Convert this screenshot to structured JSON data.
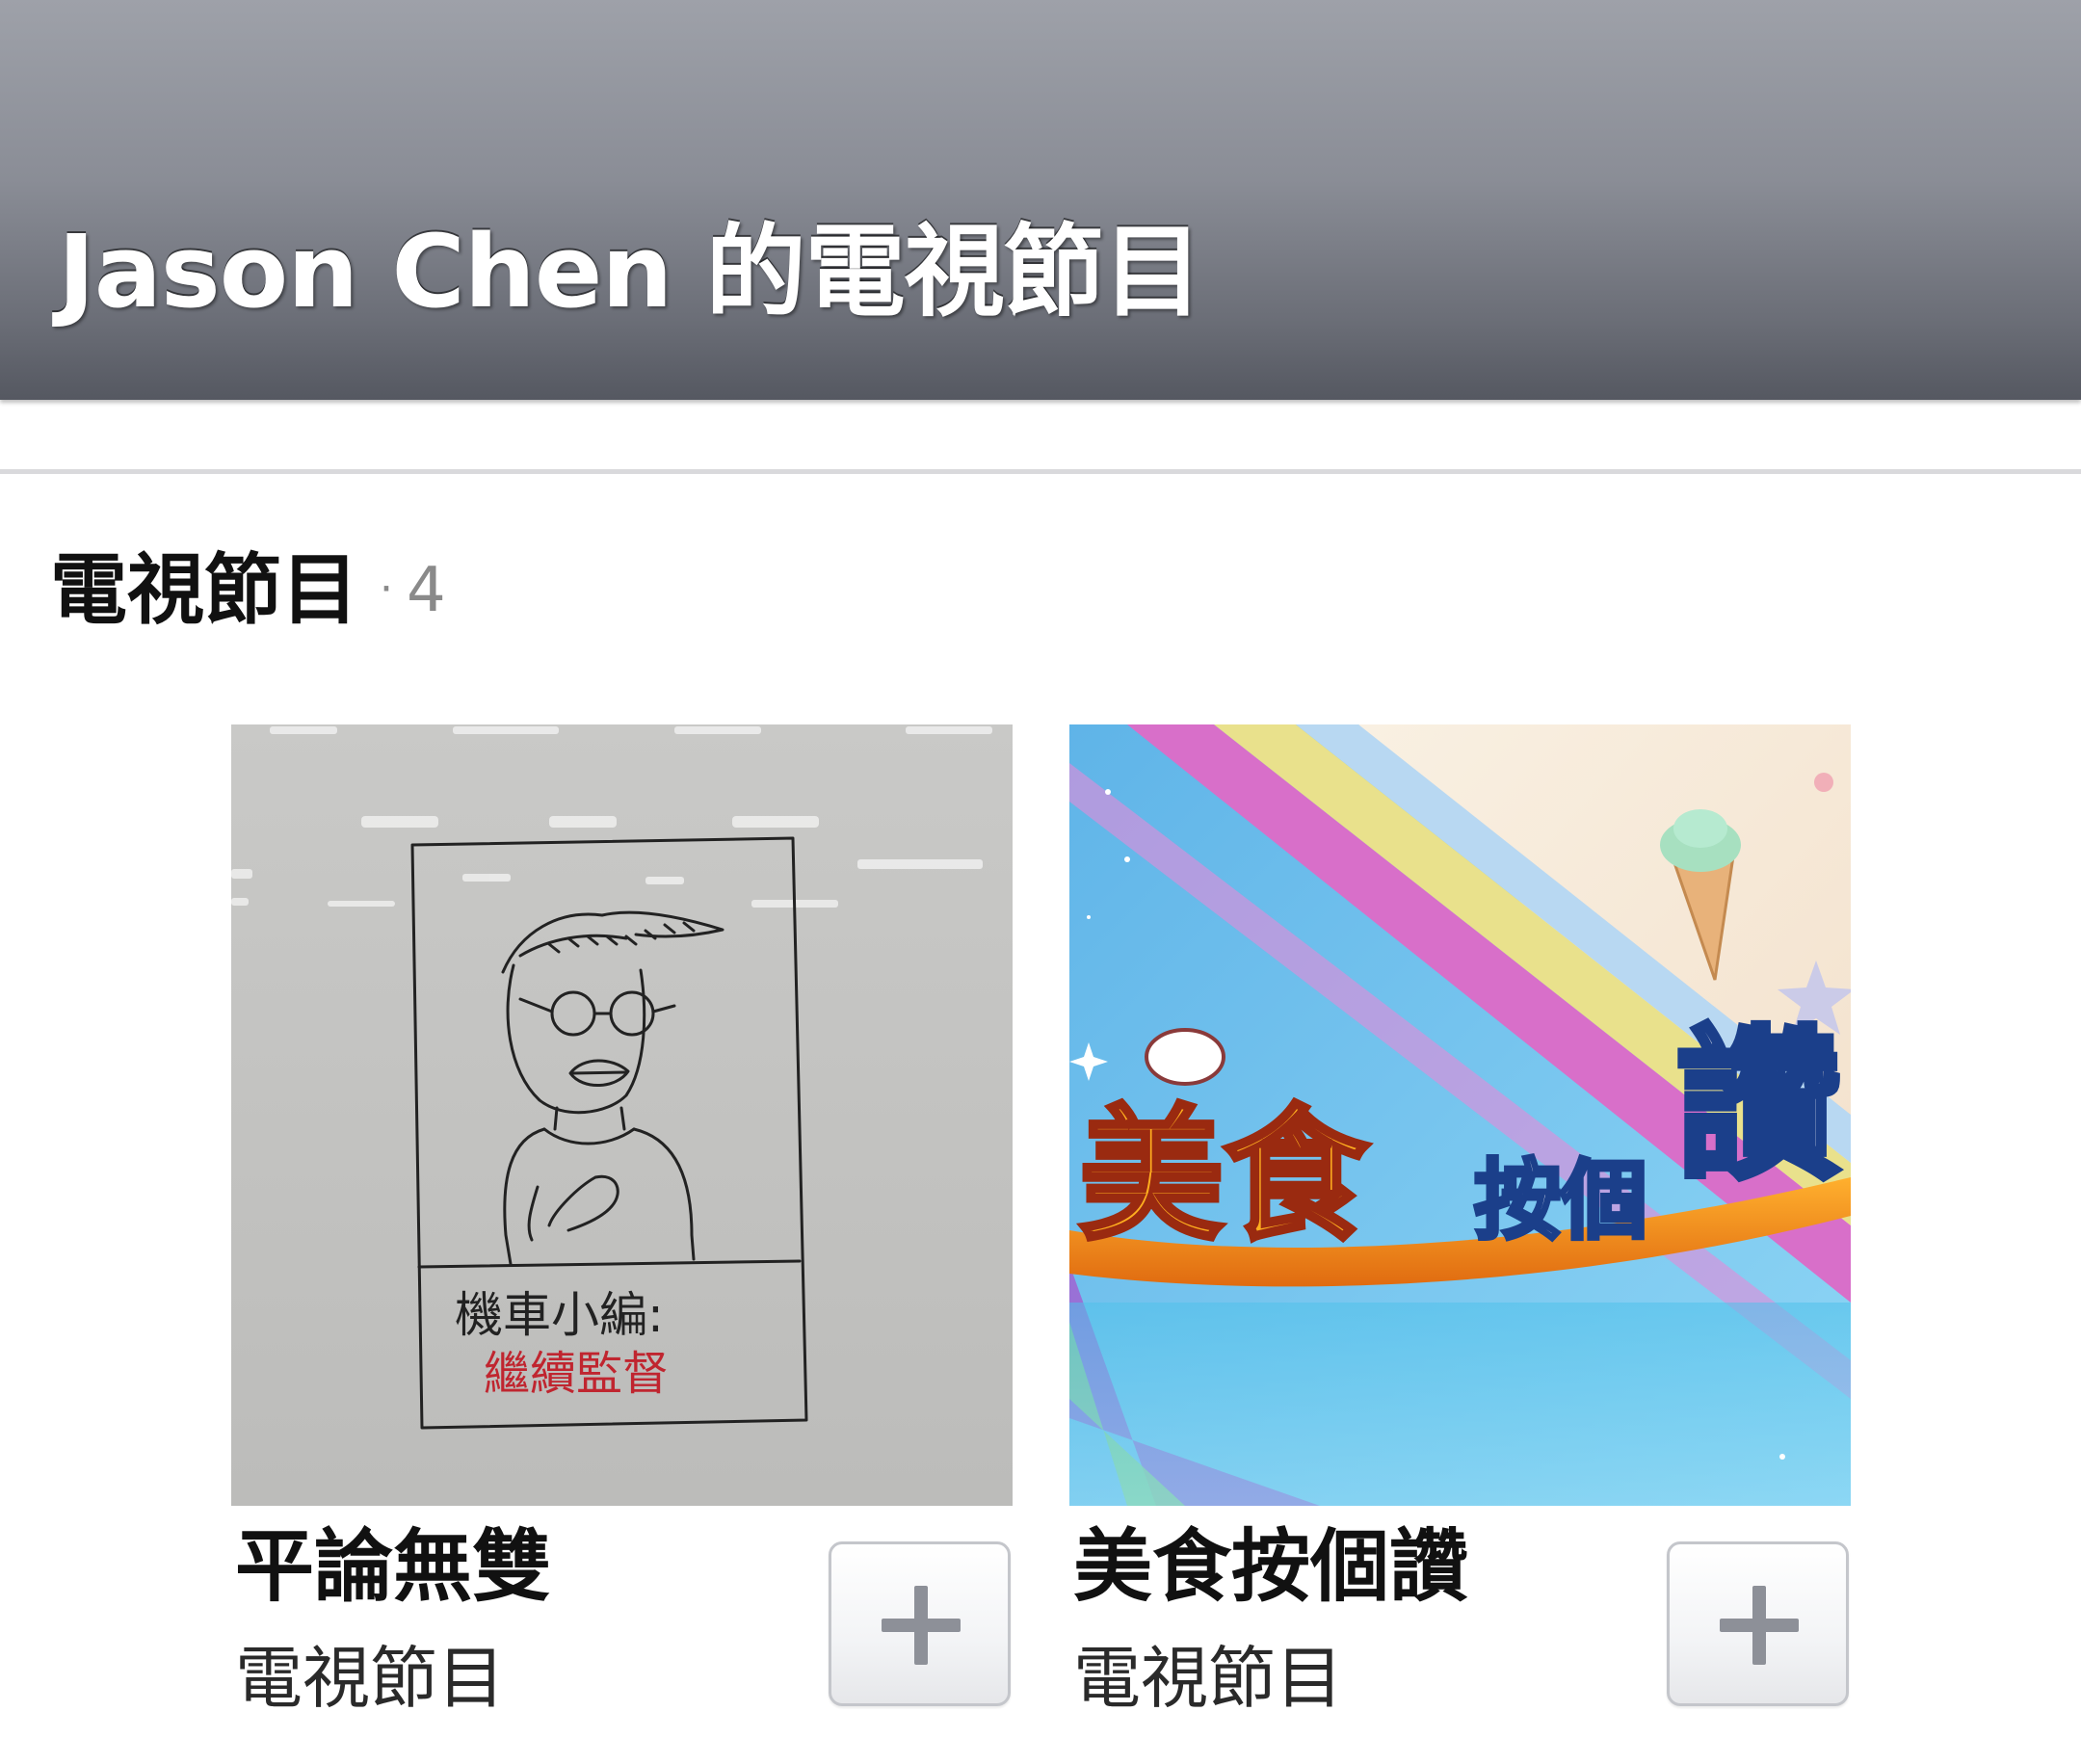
{
  "header": {
    "title": "Jason Chen 的電視節目"
  },
  "section": {
    "title": "電視節目",
    "separator": "·",
    "count": "4"
  },
  "cards": [
    {
      "name": "平論無雙",
      "category": "電視節目",
      "image_icon": "whiteboard-drawing-image",
      "drawing_caption_line1": "機車小編:",
      "drawing_caption_line2": "繼續監督",
      "add_icon": "plus-icon"
    },
    {
      "name": "美食按個讚",
      "category": "電視節目",
      "image_icon": "show-logo-image",
      "logo_text_main": "美食",
      "logo_text_small": "按個",
      "logo_text_big": "讚",
      "add_icon": "plus-icon"
    }
  ],
  "colors": {
    "header_top": "#9ea1a9",
    "header_bottom": "#555861",
    "divider": "#d9d9dc",
    "count_gray": "#8a8a8a",
    "button_border": "#c4c6cb",
    "plus": "#8d9098"
  }
}
